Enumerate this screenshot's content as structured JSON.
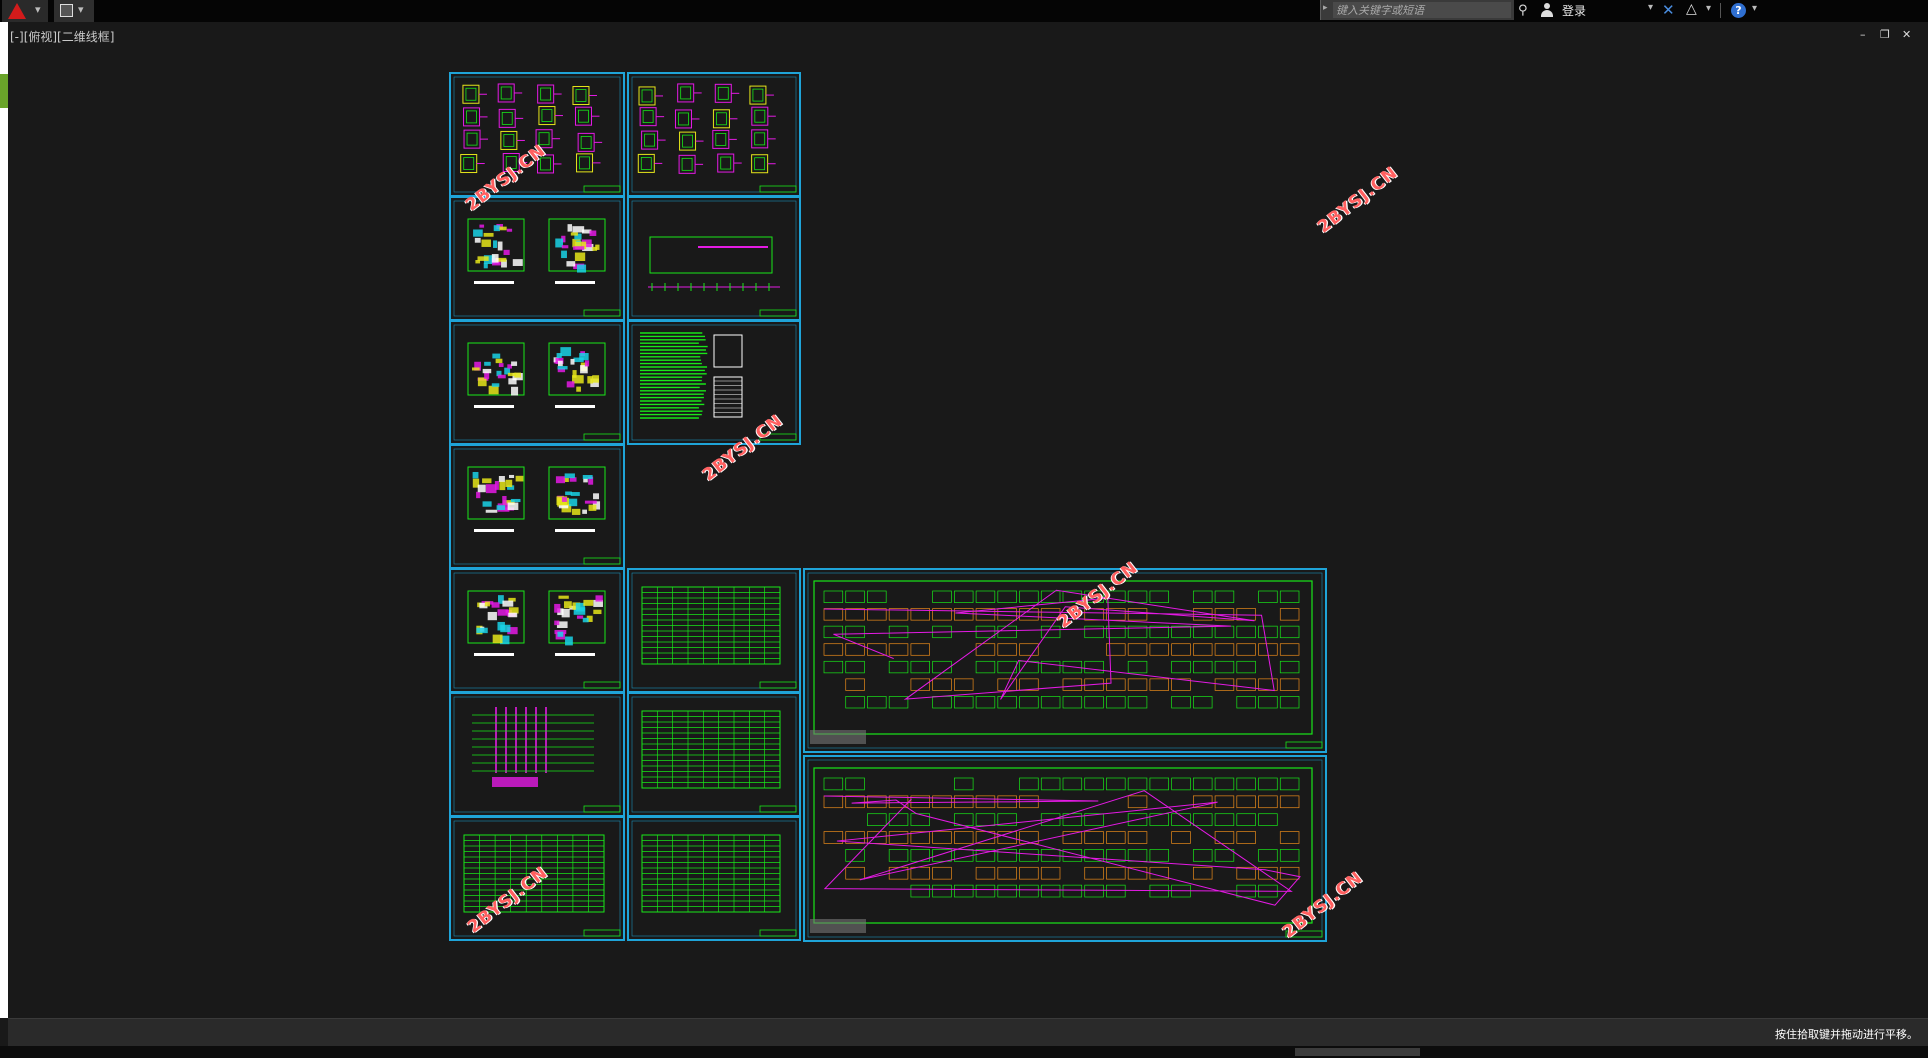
{
  "titlebar": {
    "app_icon": "autocad-logo-icon",
    "search": {
      "placeholder": "键入关键字或短语",
      "value": ""
    },
    "user_label": "登录",
    "help_label": "?"
  },
  "viewport": {
    "label": "[-][俯视][二维线框]"
  },
  "window_controls": {
    "minimize": "–",
    "restore": "❐",
    "close": "✕"
  },
  "status": {
    "message": "按住拾取键并拖动进行平移。"
  },
  "watermarks": [
    "2BYSJ.CN",
    "2BYSJ.CN",
    "2BYSJ.CN",
    "2BYSJ.CN",
    "2BYSJ.CN",
    "2BYSJ.CN"
  ],
  "colors": {
    "canvas": "#191919",
    "sheet_border": "#1fa4d8",
    "line_green": "#19e619",
    "line_magenta": "#e41ae4",
    "line_yellow": "#e6e61a",
    "line_cyan": "#1ad2e6",
    "watermark": "#ff6060"
  },
  "sheets": [
    {
      "name": "sheet-system-diagrams-1",
      "kind": "boxes"
    },
    {
      "name": "sheet-system-diagrams-2",
      "kind": "boxes"
    },
    {
      "name": "sheet-floor-plan-a",
      "kind": "plans"
    },
    {
      "name": "sheet-section",
      "kind": "section"
    },
    {
      "name": "sheet-floor-plan-b",
      "kind": "plans"
    },
    {
      "name": "sheet-design-notes",
      "kind": "notes"
    },
    {
      "name": "sheet-floor-plan-c",
      "kind": "plans"
    },
    {
      "name": "sheet-floor-plan-d",
      "kind": "plans"
    },
    {
      "name": "sheet-table-1",
      "kind": "table"
    },
    {
      "name": "sheet-riser-diagram",
      "kind": "riser"
    },
    {
      "name": "sheet-table-2",
      "kind": "table"
    },
    {
      "name": "sheet-table-3",
      "kind": "table"
    },
    {
      "name": "sheet-table-4",
      "kind": "table"
    },
    {
      "name": "sheet-garage-plan-1",
      "kind": "garage"
    },
    {
      "name": "sheet-garage-plan-2",
      "kind": "garage"
    }
  ]
}
